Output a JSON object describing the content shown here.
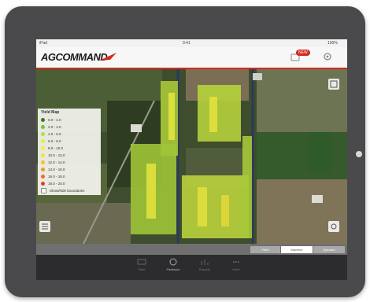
{
  "statusbar": {
    "carrier": "iPad",
    "time": "9:41",
    "battery": "100%"
  },
  "header": {
    "logo": "AGCOMMAND",
    "badge": "NEW"
  },
  "legend": {
    "title": "Yield Map",
    "rows": [
      {
        "label": "0.0 - 2.0",
        "color": "#3a7a2a"
      },
      {
        "label": "2.0 - 4.0",
        "color": "#7cbf3a"
      },
      {
        "label": "4.0 - 6.0",
        "color": "#b8dd3a"
      },
      {
        "label": "6.0 - 8.0",
        "color": "#e4ef3c"
      },
      {
        "label": "8.0 - 10.0",
        "color": "#f4ef40"
      },
      {
        "label": "10.0 - 12.0",
        "color": "#f7e23c"
      },
      {
        "label": "12.0 - 14.0",
        "color": "#f5c233"
      },
      {
        "label": "14.0 - 16.0",
        "color": "#f19a2c"
      },
      {
        "label": "16.0 - 18.0",
        "color": "#ea6d25"
      },
      {
        "label": "18.0 - 20.0",
        "color": "#e0401f"
      }
    ],
    "footer": "Show/hide boundaries"
  },
  "segments": [
    "Field",
    "Machine",
    "Operator"
  ],
  "tabs": [
    "Fleet",
    "Fieldwork",
    "Reports",
    "More"
  ]
}
